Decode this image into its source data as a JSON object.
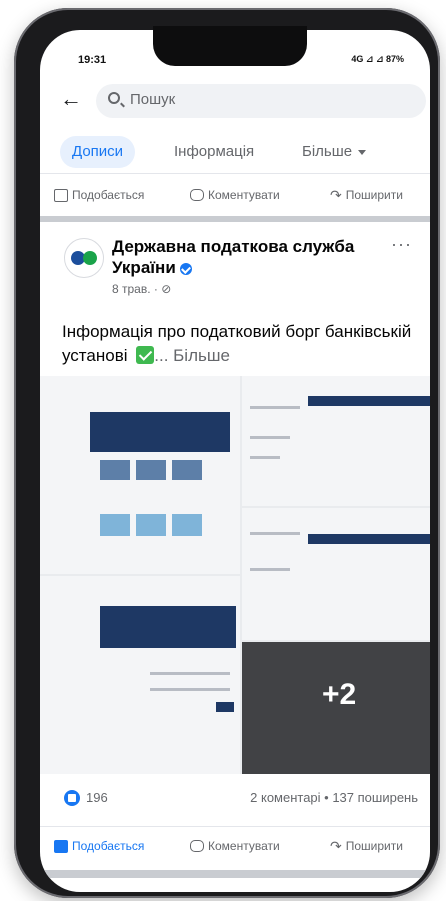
{
  "status_bar": {
    "time": "19:31",
    "icons": "4G ⊿ ⊿ 87%"
  },
  "search": {
    "placeholder": "Пошук"
  },
  "tabs": [
    {
      "label": "Дописи",
      "active": true
    },
    {
      "label": "Інформація",
      "active": false
    },
    {
      "label": "Більше",
      "active": false
    }
  ],
  "actions_top": {
    "like": "Подобається",
    "comment": "Коментувати",
    "share": "Поширити"
  },
  "post": {
    "page_name": "Державна податкова служба України",
    "date": "8 трав. · ",
    "text": "Інформація про податковий борг банківській установі",
    "see_more": "... Більше",
    "extra_images": "+2"
  },
  "stats": {
    "likes": "196",
    "comments_shares": "2 коментарі • 137 поширень"
  },
  "actions_bottom": {
    "like": "Подобається",
    "comment": "Коментувати",
    "share": "Поширити"
  },
  "colors": {
    "accent": "#1877f2",
    "check": "#3fb950",
    "gov_blue": "#1e3864"
  }
}
